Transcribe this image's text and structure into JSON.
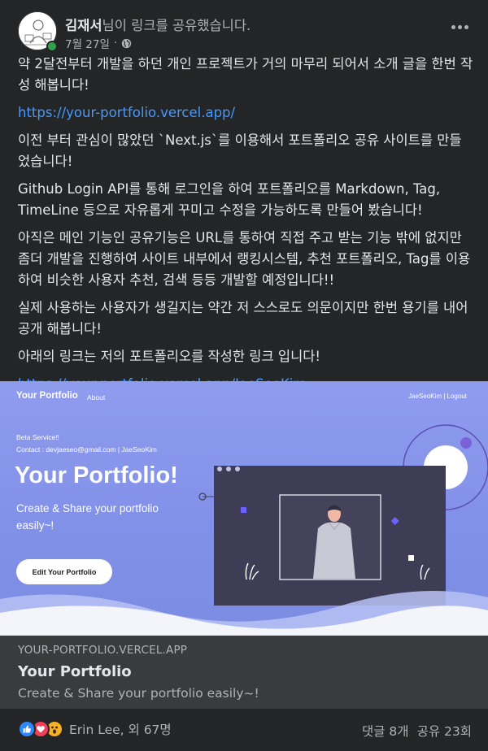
{
  "header": {
    "author": "김재서",
    "action_text": "님이 링크를 공유했습니다.",
    "date": "7월 27일",
    "separator": "·",
    "privacy_icon": "globe-icon",
    "more_icon": "more-horizontal-icon"
  },
  "body": {
    "p1": "약 2달전부터 개발을 하던 개인 프로젝트가 거의 마무리 되어서 소개 글을 한번 작성 해봅니다!",
    "link1": "https://your-portfolio.vercel.app/",
    "p2": "이전 부터 관심이 많았던 `Next.js`를 이용해서 포트폴리오 공유 사이트를 만들었습니다!",
    "p3": "Github Login API를 통해 로그인을 하여 포트폴리오를 Markdown, Tag, TimeLine 등으로 자유롭게 꾸미고 수정을 가능하도록 만들어 봤습니다!",
    "p4": "아직은 메인 기능인 공유기능은 URL를 통하여 직접 주고 받는 기능 밖에 없지만 좀더 개발을 진행하여 사이트 내부에서 랭킹시스템, 추천 포트폴리오, Tag를 이용하여 비슷한 사용자 추천, 검색 등등 개발할 예정입니다!!",
    "p5": "실제 사용하는 사용자가 생길지는 약간 저 스스로도 의문이지만 한번 용기를 내어 공개 해봅니다!",
    "p6": "아래의 링크는 저의 포트폴리오를 작성한 링크 입니다!",
    "link2": "https://your-portfolio.vercel.app/JaeSeoKim"
  },
  "preview": {
    "brand": "Your Portfolio",
    "nav_about": "About",
    "user_nav": "JaeSeoKim  |  Logout",
    "beta": "Beta Service!!",
    "contact": "Contact : devjaeseo@gmail.com | JaeSeoKim",
    "hero_title": "Your Portfolio!",
    "hero_subtitle": "Create & Share your portfolio easily~!",
    "cta": "Edit Your Portfolio"
  },
  "link_card": {
    "domain": "YOUR-PORTFOLIO.VERCEL.APP",
    "title": "Your Portfolio",
    "description": "Create & Share your portfolio easily~!"
  },
  "footer": {
    "reaction_icons": [
      "like-icon",
      "love-icon",
      "wow-icon"
    ],
    "reaction_names": "Erin Lee, 외 67명",
    "comments": "댓글 8개",
    "shares": "공유 23회"
  },
  "colors": {
    "background": "#242526",
    "link": "#4599ff",
    "preview_bg": "#8291e8",
    "link_card_bg": "#3a3b3c",
    "like": "#2d88ff",
    "love": "#f33e58",
    "wow": "#f7b125"
  }
}
